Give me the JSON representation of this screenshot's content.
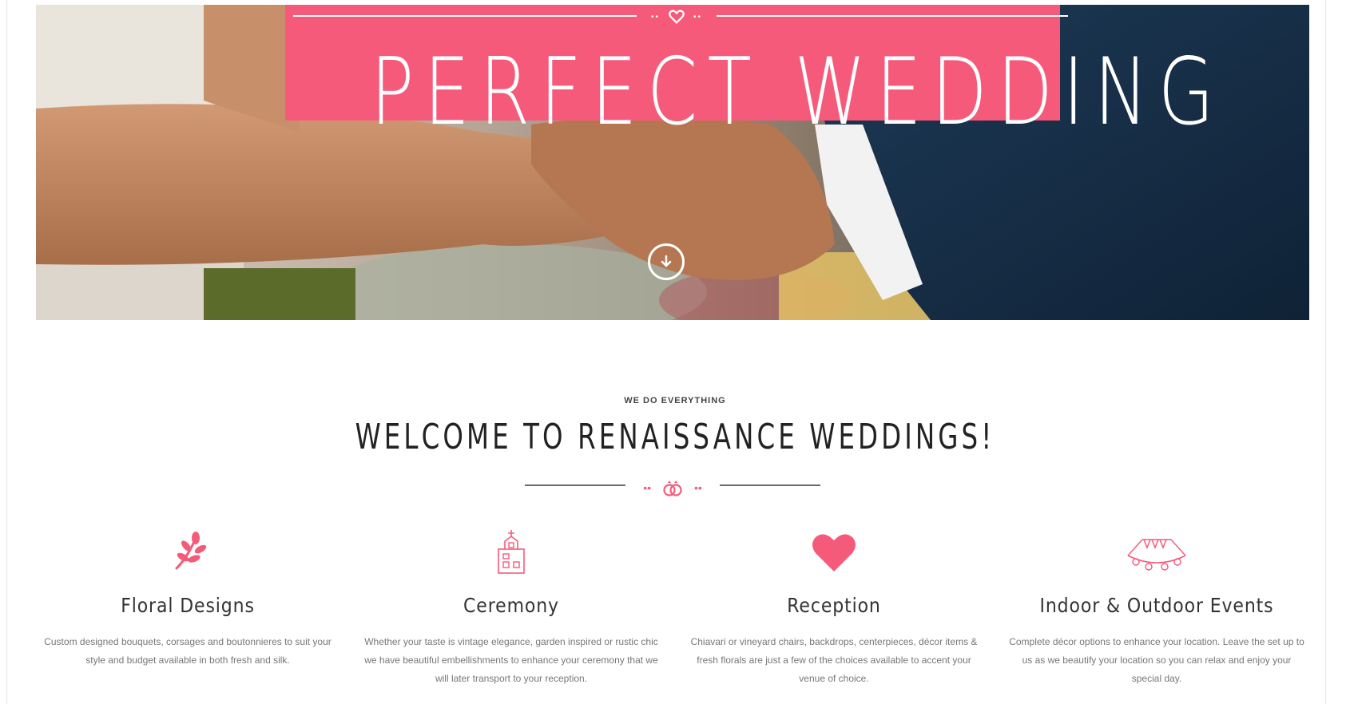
{
  "colors": {
    "accent": "#f65a7b",
    "heading": "#222222",
    "body_text": "#777777"
  },
  "hero": {
    "title": "PERFECT WEDDING",
    "scroll_icon": "arrow-down-circle-icon",
    "ornament_icon": "heart-icon"
  },
  "welcome": {
    "eyebrow": "WE DO EVERYTHING",
    "title": "WELCOME TO RENAISSANCE WEDDINGS!",
    "divider_icon": "rings-icon"
  },
  "features": [
    {
      "icon": "floral-branch-icon",
      "title": "Floral Designs",
      "text": "Custom designed bouquets, corsages and boutonnieres to suit your style and budget available in both fresh and silk."
    },
    {
      "icon": "chapel-icon",
      "title": "Ceremony",
      "text": "Whether your taste is vintage elegance, garden inspired or rustic chic we have beautiful embellishments to enhance your ceremony that we will later transport to your reception."
    },
    {
      "icon": "heart-icon",
      "title": "Reception",
      "text": "Chiavari or vineyard chairs, backdrops, centerpieces, décor items & fresh florals are just a few of the choices available to accent your venue of choice."
    },
    {
      "icon": "bunting-garland-icon",
      "title": "Indoor & Outdoor Events",
      "text": "Complete décor options to enhance your location. Leave the set up to us as we beautify your location so you can relax and enjoy your special day."
    }
  ]
}
